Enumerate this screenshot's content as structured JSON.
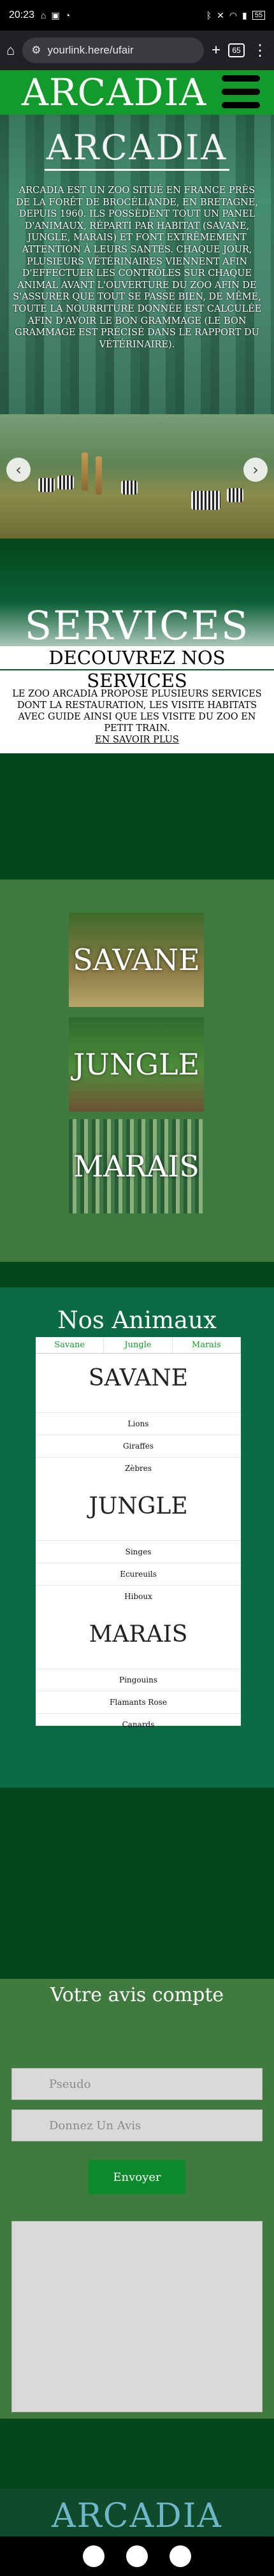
{
  "status": {
    "time": "20:23",
    "icons": [
      "home-small-icon",
      "image-icon",
      "chat-icon"
    ],
    "right_icons": [
      "bluetooth-icon",
      "mute-icon",
      "wifi-icon",
      "signal-icon",
      "battery-icon"
    ],
    "battery": "55"
  },
  "browser": {
    "url": "yourlink.here/ufair",
    "tab_count": "65"
  },
  "header": {
    "logo": "ARCADIA"
  },
  "hero": {
    "title": "ARCADIA",
    "text": "ARCADIA EST UN ZOO SITUÉ EN FRANCE PRÈS DE LA FORÊT DE BROCÉLIANDE, EN BRETAGNE, DEPUIS 1960. ILS POSSÈDENT TOUT UN PANEL D'ANIMAUX, RÉPARTI PAR HABITAT (SAVANE, JUNGLE, MARAIS) ET FONT EXTRÊMEMENT ATTENTION À LEURS SANTÉS. CHAQUE JOUR, PLUSIEURS VÉTÉRINAIRES VIENNENT AFIN D'EFFECTUER LES CONTRÔLES SUR CHAQUE ANIMAL AVANT L'OUVERTURE DU ZOO AFIN DE S'ASSURER QUE TOUT SE PASSE BIEN, DE MÊME, TOUTE LA NOURRITURE DONNÉE EST CALCULÉE AFIN D'AVOIR LE BON GRAMMAGE (LE BON GRAMMAGE EST PRÉCISÉ DANS LE RAPPORT DU VÉTÉRINAIRE)."
  },
  "services": {
    "title": "SERVICES",
    "subtitle": "DECOUVREZ NOS SERVICES",
    "text": "LE ZOO ARCADIA PROPOSE PLUSIEURS SERVICES DONT LA RESTAURATION, LES VISITE HABITATS AVEC GUIDE AINSI QUE LES VISITE DU ZOO EN PETIT TRAIN.",
    "link": "EN SAVOIR PLUS"
  },
  "habitats": [
    "SAVANE",
    "JUNGLE",
    "MARAIS"
  ],
  "animals": {
    "title": "Nos Animaux",
    "tabs": [
      "Savane",
      "Jungle",
      "Marais"
    ],
    "groups": [
      {
        "name": "SAVANE",
        "items": [
          "Lions",
          "Giraffes",
          "Zèbres"
        ]
      },
      {
        "name": "JUNGLE",
        "items": [
          "Singes",
          "Ecureuils",
          "Hiboux"
        ]
      },
      {
        "name": "MARAIS",
        "items": [
          "Pingouins",
          "Flamants Rose",
          "Canards"
        ]
      }
    ]
  },
  "avis": {
    "title": "Votre avis compte",
    "pseudo_placeholder": "Pseudo",
    "avis_placeholder": "Donnez Un Avis",
    "button": "Envoyer"
  },
  "footer": {
    "logo": "ARCADIA"
  },
  "colors": {
    "green": "#129a2b",
    "dark_green": "#04471a",
    "mid_green": "#417a3f",
    "teal": "#0a6b45"
  }
}
